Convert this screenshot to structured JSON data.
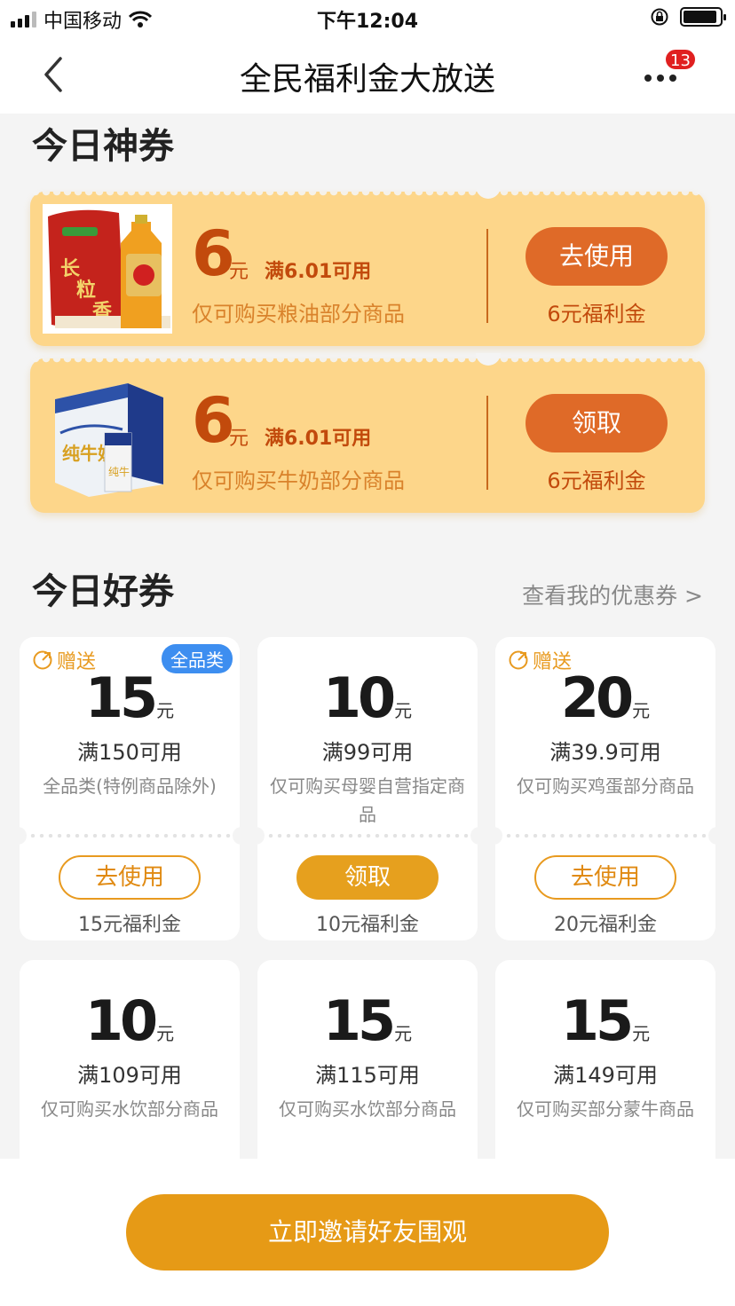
{
  "status_bar": {
    "carrier": "中国移动",
    "time": "下午12:04"
  },
  "nav": {
    "title": "全民福利金大放送",
    "badge": "13"
  },
  "sections": {
    "today_special": "今日神券",
    "today_good": "今日好券",
    "see_mine": "查看我的优惠券 >"
  },
  "big_coupons": [
    {
      "amount": "6",
      "unit": "元",
      "condition": "满6.01可用",
      "desc": "仅可购买粮油部分商品",
      "button": "去使用",
      "value": "6元福利金",
      "image": "rice-and-oil-product"
    },
    {
      "amount": "6",
      "unit": "元",
      "condition": "满6.01可用",
      "desc": "仅可购买牛奶部分商品",
      "button": "领取",
      "value": "6元福利金",
      "image": "milk-box-product"
    }
  ],
  "coupons": [
    {
      "gift": "赠送",
      "tag": "全品类",
      "amount": "15",
      "unit": "元",
      "condition": "满150可用",
      "desc": "全品类(特例商品除外)",
      "button": "去使用",
      "button_style": "outline",
      "value": "15元福利金"
    },
    {
      "amount": "10",
      "unit": "元",
      "condition": "满99可用",
      "desc": "仅可购买母婴自营指定商品",
      "button": "领取",
      "button_style": "fill",
      "value": "10元福利金"
    },
    {
      "gift": "赠送",
      "amount": "20",
      "unit": "元",
      "condition": "满39.9可用",
      "desc": "仅可购买鸡蛋部分商品",
      "button": "去使用",
      "button_style": "outline",
      "value": "20元福利金"
    },
    {
      "amount": "10",
      "unit": "元",
      "condition": "满109可用",
      "desc": "仅可购买水饮部分商品"
    },
    {
      "amount": "15",
      "unit": "元",
      "condition": "满115可用",
      "desc": "仅可购买水饮部分商品"
    },
    {
      "amount": "15",
      "unit": "元",
      "condition": "满149可用",
      "desc": "仅可购买部分蒙牛商品"
    }
  ],
  "bottom": {
    "invite": "立即邀请好友围观"
  },
  "colors": {
    "accent": "#e69a16",
    "coupon_bg": "#fdd68a",
    "coupon_text": "#c24a0c",
    "button_orange": "#df6a28",
    "badge_red": "#e02020",
    "tag_blue": "#3d8ef0"
  }
}
